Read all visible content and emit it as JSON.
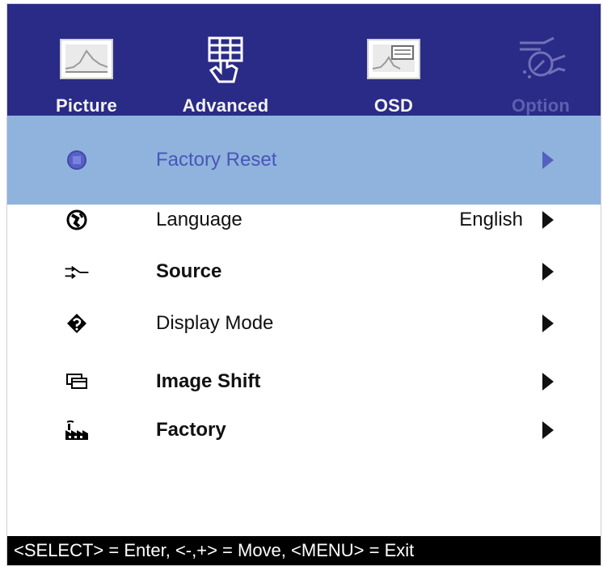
{
  "tabs": [
    {
      "label": "Picture",
      "icon": "picture-icon",
      "active": false
    },
    {
      "label": "Advanced",
      "icon": "advanced-icon",
      "active": false
    },
    {
      "label": "OSD",
      "icon": "osd-icon",
      "active": false
    },
    {
      "label": "Option",
      "icon": "option-icon",
      "active": true
    }
  ],
  "menu": {
    "items": [
      {
        "label": "Factory Reset",
        "icon": "factory-reset-icon",
        "value": "",
        "selected": true
      },
      {
        "label": "Language",
        "icon": "language-icon",
        "value": "English",
        "selected": false
      },
      {
        "label": "Source",
        "icon": "source-icon",
        "value": "",
        "selected": false
      },
      {
        "label": "Display Mode",
        "icon": "display-mode-icon",
        "value": "",
        "selected": false
      },
      {
        "label": "Image Shift",
        "icon": "image-shift-icon",
        "value": "",
        "selected": false
      },
      {
        "label": "Factory",
        "icon": "factory-icon",
        "value": "",
        "selected": false
      }
    ]
  },
  "status": {
    "hint": "<SELECT> = Enter, <-,+> = Move, <MENU> = Exit"
  },
  "colors": {
    "header_bg": "#2a2b86",
    "selected_row_bg": "#8fb3dd",
    "active_tab_text": "#5d5fb0",
    "status_bar_bg": "#000000"
  }
}
